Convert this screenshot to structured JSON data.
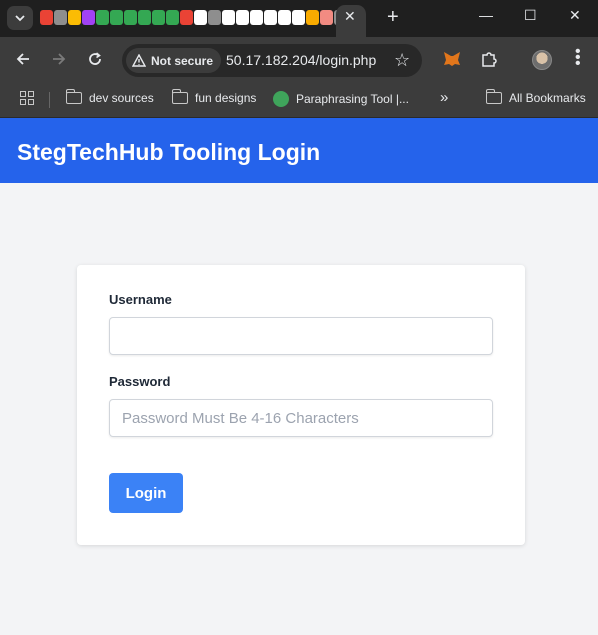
{
  "browser": {
    "active_tab_close": "✕",
    "new_tab": "+",
    "window": {
      "minimize": "—",
      "maximize": "☐",
      "close": "✕"
    },
    "security_label": "Not secure",
    "url": "50.17.182.204/login.php",
    "favicon_colors": [
      "#ea4335",
      "#8e8e8e",
      "#fbbc04",
      "#a142f4",
      "#34a853",
      "#34a853",
      "#34a853",
      "#34a853",
      "#34a853",
      "#34a853",
      "#ea4335",
      "#ffffff",
      "#8e8e8e",
      "#ffffff",
      "#ffffff",
      "#ffffff",
      "#ffffff",
      "#ffffff",
      "#ffffff",
      "#f9ab00",
      "#f28b82",
      "#8e8e8e"
    ],
    "bookmarks": {
      "items": [
        "dev sources",
        "fun designs",
        "Paraphrasing Tool |..."
      ],
      "overflow": "»",
      "all_label": "All Bookmarks"
    }
  },
  "page": {
    "title": "StegTechHub Tooling Login",
    "form": {
      "username_label": "Username",
      "username_value": "",
      "password_label": "Password",
      "password_placeholder": "Password Must Be 4-16 Characters",
      "login_label": "Login"
    }
  },
  "colors": {
    "header_bg": "#2563eb",
    "button_bg": "#3b82f6",
    "page_bg": "#f3f4f6"
  }
}
